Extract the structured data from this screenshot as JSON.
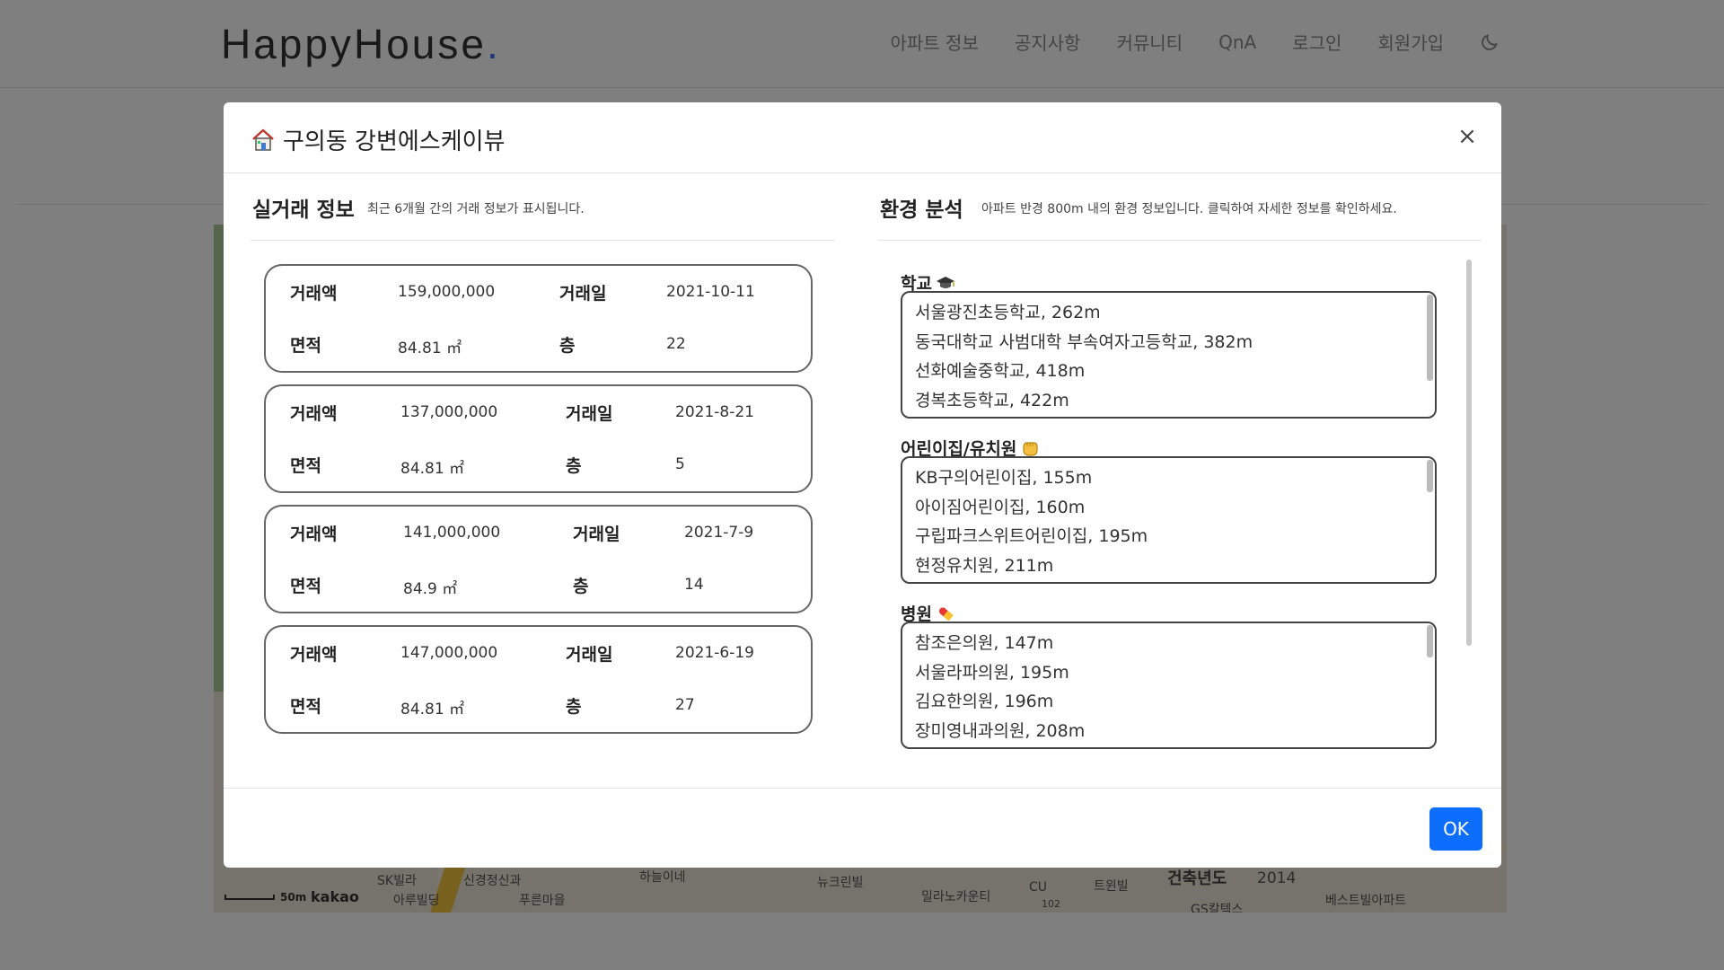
{
  "navbar": {
    "brand": "HappyHouse",
    "brand_dot": ".",
    "menu": [
      "아파트 정보",
      "공지사항",
      "커뮤니티",
      "QnA",
      "로그인",
      "회원가입"
    ]
  },
  "map": {
    "labels": [
      "SK빌라",
      "신경정신과",
      "하늘이네",
      "뉴크린빌",
      "CU",
      "트윈빌",
      "아루빌딩",
      "푸른마을",
      "밀라노카운티",
      "GS칼텍스",
      "베스트빌아파트",
      "102"
    ],
    "built_year_label": "건축년도",
    "built_year_value": "2014",
    "scale": "50m",
    "logo": "kakao"
  },
  "modal": {
    "title": "구의동 강변에스케이뷰",
    "close": "×",
    "ok_label": "OK"
  },
  "deals": {
    "title": "실거래 정보",
    "subtitle": "최근 6개월 간의 거래 정보가 표시됩니다.",
    "labels": {
      "price": "거래액",
      "date": "거래일",
      "area": "면적",
      "floor": "층"
    },
    "items": [
      {
        "price": "159,000,000",
        "date": "2021-10-11",
        "area": "84.81 ㎡",
        "floor": "22"
      },
      {
        "price": "137,000,000",
        "date": "2021-8-21",
        "area": "84.81 ㎡",
        "floor": "5"
      },
      {
        "price": "141,000,000",
        "date": "2021-7-9",
        "area": "84.9 ㎡",
        "floor": "14"
      },
      {
        "price": "147,000,000",
        "date": "2021-6-19",
        "area": "84.81 ㎡",
        "floor": "27"
      }
    ]
  },
  "env": {
    "title": "환경 분석",
    "subtitle": "아파트 반경 800m 내의 환경 정보입니다. 클릭하여 자세한 정보를 확인하세요.",
    "groups": [
      {
        "name": "학교",
        "icon": "graduation-cap-icon",
        "items": [
          "서울광진초등학교, 262m",
          "동국대학교 사범대학 부속여자고등학교, 382m",
          "선화예술중학교, 418m",
          "경복초등학교, 422m"
        ]
      },
      {
        "name": "어린이집/유치원",
        "icon": "baby-hand-icon",
        "items": [
          "KB구의어린이집, 155m",
          "아이짐어린이집, 160m",
          "구립파크스위트어린이집, 195m",
          "현정유치원, 211m"
        ]
      },
      {
        "name": "병원",
        "icon": "pill-icon",
        "items": [
          "참조은의원, 147m",
          "서울라파의원, 195m",
          "김요한의원, 196m",
          "장미영내과의원, 208m"
        ]
      }
    ]
  },
  "colors": {
    "primary": "#0d6efd",
    "brand_dot": "#3b6df0"
  }
}
